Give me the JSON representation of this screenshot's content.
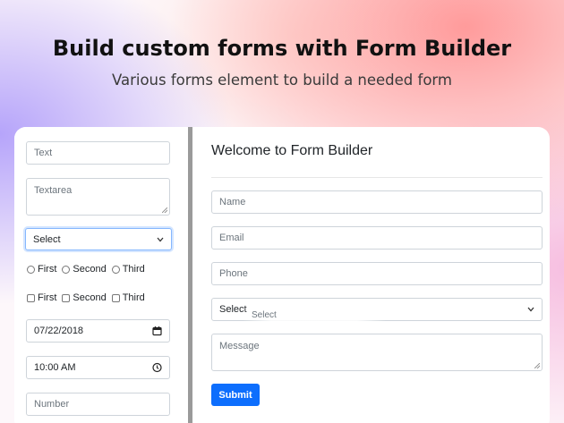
{
  "hero": {
    "title": "Build custom forms with Form Builder",
    "subtitle": "Various forms element to build a needed form"
  },
  "palette": {
    "text_placeholder": "Text",
    "textarea_placeholder": "Textarea",
    "select_value": "Select",
    "radios": [
      "First",
      "Second",
      "Third"
    ],
    "checkboxes": [
      "First",
      "Second",
      "Third"
    ],
    "date_value": "07/22/2018",
    "time_value": "10:00 AM",
    "number_placeholder": "Number"
  },
  "preview": {
    "title": "Welcome to Form Builder",
    "name_placeholder": "Name",
    "email_placeholder": "Email",
    "phone_placeholder": "Phone",
    "select_value": "Select",
    "dragging_label": "Select",
    "message_placeholder": "Message",
    "submit_label": "Submit"
  },
  "colors": {
    "primary": "#0d6efd",
    "divider": "#9a9a9a"
  }
}
